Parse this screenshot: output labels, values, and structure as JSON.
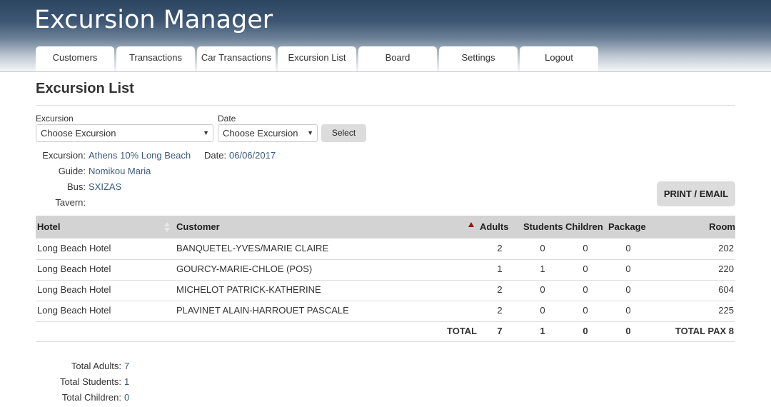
{
  "app": {
    "title": "Excursion Manager"
  },
  "nav": {
    "tabs": [
      {
        "label": "Customers"
      },
      {
        "label": "Transactions"
      },
      {
        "label": "Car Transactions"
      },
      {
        "label": "Excursion List"
      },
      {
        "label": "Board"
      },
      {
        "label": "Settings"
      },
      {
        "label": "Logout"
      }
    ]
  },
  "page": {
    "title": "Excursion List"
  },
  "filters": {
    "excursion_label": "Excursion",
    "excursion_value": "Choose Excursion",
    "date_label": "Date",
    "date_value": "Choose Excursion",
    "select_button": "Select"
  },
  "info": {
    "excursion_key": "Excursion:",
    "excursion_value": "Athens 10% Long Beach",
    "date_key": "Date:",
    "date_value": "06/06/2017",
    "guide_key": "Guide:",
    "guide_value": "Nomikou Maria",
    "bus_key": "Bus:",
    "bus_value": "SXIZAS",
    "tavern_key": "Tavern:",
    "tavern_value": ""
  },
  "actions": {
    "print_email": "PRINT / EMAIL"
  },
  "table": {
    "columns": {
      "hotel": "Hotel",
      "customer": "Customer",
      "adults": "Adults",
      "students": "Students",
      "children": "Children",
      "package": "Package",
      "room": "Room"
    },
    "rows": [
      {
        "hotel": "Long Beach Hotel",
        "customer": "BANQUETEL-YVES/MARIE CLAIRE",
        "adults": "2",
        "students": "0",
        "children": "0",
        "package": "0",
        "room": "202"
      },
      {
        "hotel": "Long Beach Hotel",
        "customer": "GOURCY-MARIE-CHLOE (POS)",
        "adults": "1",
        "students": "1",
        "children": "0",
        "package": "0",
        "room": "220"
      },
      {
        "hotel": "Long Beach Hotel",
        "customer": "MICHELOT PATRICK-KATHERINE",
        "adults": "2",
        "students": "0",
        "children": "0",
        "package": "0",
        "room": "604"
      },
      {
        "hotel": "Long Beach Hotel",
        "customer": "PLAVINET ALAIN-HARROUET PASCALE",
        "adults": "2",
        "students": "0",
        "children": "0",
        "package": "0",
        "room": "225"
      }
    ],
    "totals": {
      "label": "TOTAL",
      "adults": "7",
      "students": "1",
      "children": "0",
      "package": "0",
      "pax": "TOTAL PAX 8"
    }
  },
  "summary": {
    "adults_key": "Total Adults:",
    "adults_value": "7",
    "students_key": "Total Students:",
    "students_value": "1",
    "children_key": "Total Children:",
    "children_value": "0"
  },
  "colors": {
    "header_top": "#2c4560",
    "link_value": "#3a5a7c",
    "table_header_bg": "#d3d3d3",
    "button_bg": "#dcdcdc",
    "sort_active": "#8b1a1a"
  }
}
